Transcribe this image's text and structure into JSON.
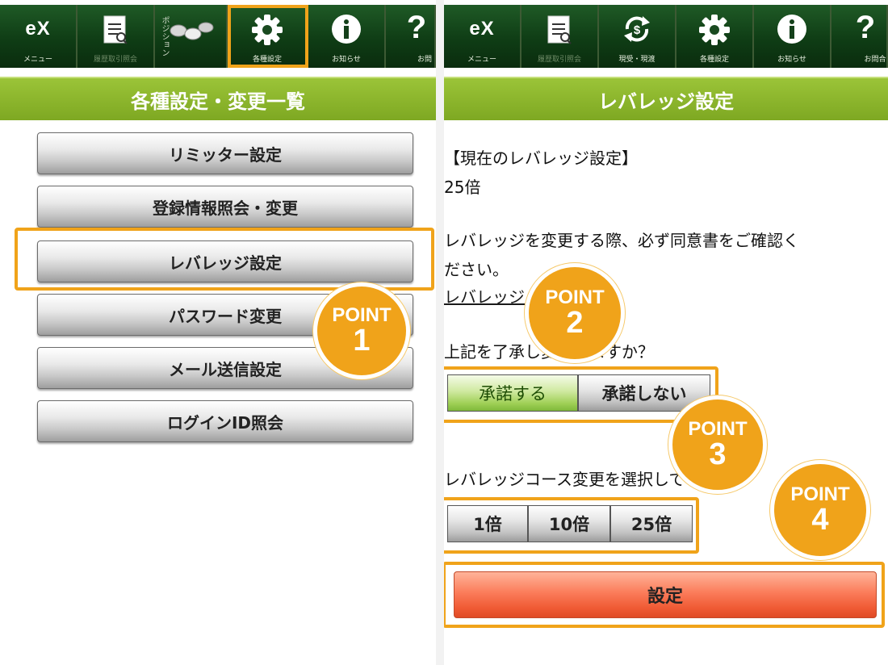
{
  "left": {
    "toolbar": [
      {
        "label": "メニュー",
        "icon": "ex-logo-icon"
      },
      {
        "label": "履歴取引照会",
        "icon": "notepad-icon"
      },
      {
        "label": "ポジション",
        "icon": "coins-icon"
      },
      {
        "label": "各種設定",
        "icon": "gear-icon",
        "active": true
      },
      {
        "label": "お知らせ",
        "icon": "info-icon"
      },
      {
        "label": "お問",
        "icon": "help-icon"
      }
    ],
    "title": "各種設定・変更一覧",
    "menu": [
      "リミッター設定",
      "登録情報照会・変更",
      "レバレッジ設定",
      "パスワード変更",
      "メール送信設定",
      "ログインID照会"
    ],
    "point1": {
      "word": "POINT",
      "num": "1"
    }
  },
  "right": {
    "toolbar": [
      {
        "label": "メニュー",
        "icon": "ex-logo-icon"
      },
      {
        "label": "履歴取引照会",
        "icon": "notepad-icon"
      },
      {
        "label": "現受・現渡",
        "icon": "dollar-exchange-icon"
      },
      {
        "label": "各種設定",
        "icon": "gear-icon"
      },
      {
        "label": "お知らせ",
        "icon": "info-icon"
      },
      {
        "label": "お問合",
        "icon": "help-icon"
      }
    ],
    "title": "レバレッジ設定",
    "current_label": "【現在のレバレッジ設定】",
    "current_value": "25倍",
    "notice_line1": "レバレッジを変更する際、必ず同意書をご確認く",
    "notice_line2": "ださい。",
    "link_text": "レバレッジ",
    "consent_question": "上記を了承し変更しますか？",
    "agree_label": "承諾する",
    "disagree_label": "承諾しない",
    "course_prompt": "レバレッジコース変更を選択してください",
    "options": [
      "1倍",
      "10倍",
      "25倍"
    ],
    "submit_label": "設定",
    "point2": {
      "word": "POINT",
      "num": "2"
    },
    "point3": {
      "word": "POINT",
      "num": "3"
    },
    "point4": {
      "word": "POINT",
      "num": "4"
    }
  },
  "colors": {
    "toolbar_bg": "#0f3d15",
    "title_bar": "#8ab62a",
    "highlight": "#f0a31a",
    "agree_green": "#9ecf55",
    "submit_red": "#ef5a34"
  }
}
